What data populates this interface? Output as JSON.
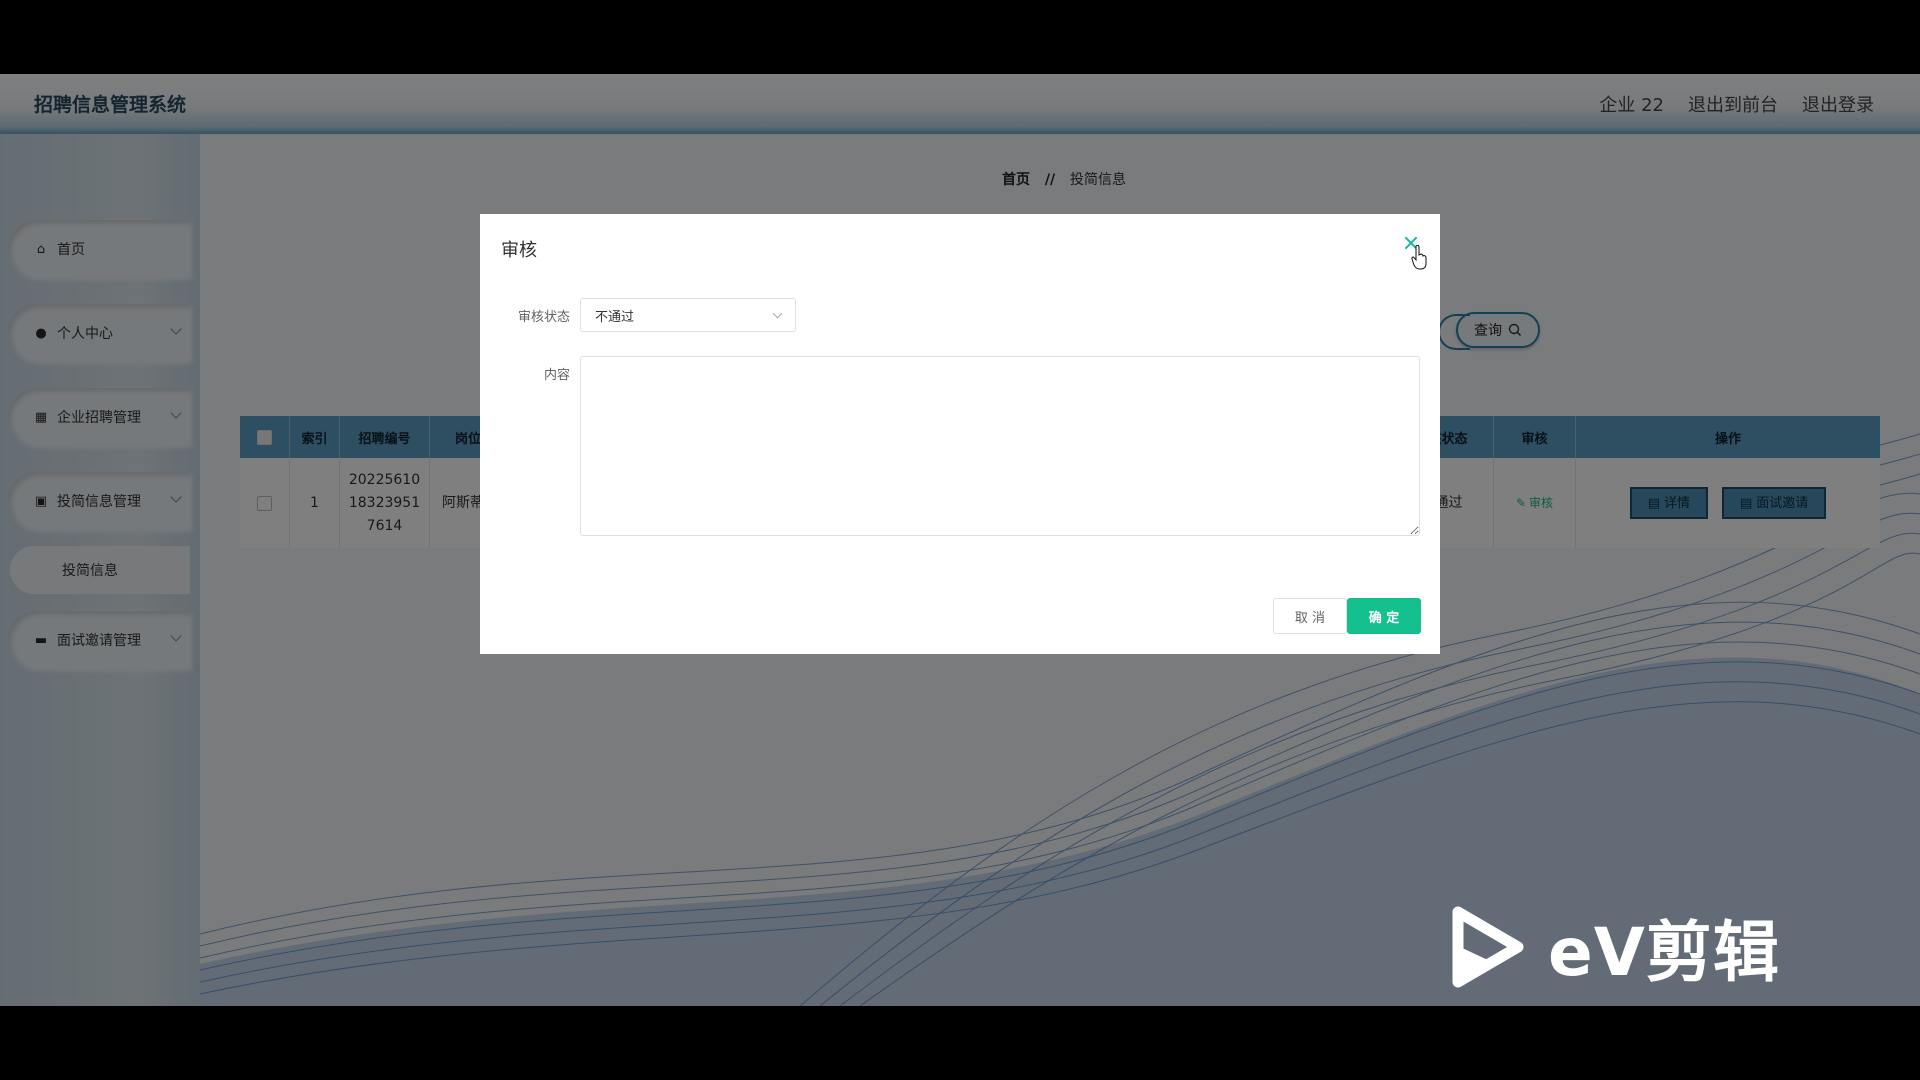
{
  "header": {
    "title": "招聘信息管理系统",
    "nav": [
      "企业 22",
      "退出到前台",
      "退出登录"
    ]
  },
  "sidebar": {
    "items": [
      {
        "label": "首页",
        "icon": "home-icon"
      },
      {
        "label": "个人中心",
        "icon": "user-icon"
      },
      {
        "label": "企业招聘管理",
        "icon": "grid-icon"
      },
      {
        "label": "投简信息管理",
        "icon": "clipboard-icon"
      },
      {
        "label": "投简信息",
        "icon": ""
      },
      {
        "label": "面试邀请管理",
        "icon": "briefcase-icon"
      }
    ]
  },
  "breadcrumb": {
    "home": "首页",
    "sep": "//",
    "current": "投简信息"
  },
  "search": {
    "query_label": "查询"
  },
  "table": {
    "headers": {
      "index": "索引",
      "code": "招聘编号",
      "position": "岗位名",
      "status": "审核状态",
      "review": "审核",
      "ops": "操作"
    },
    "rows": [
      {
        "index": "1",
        "code_lines": [
          "20225610",
          "18323951",
          "7614"
        ],
        "position": "阿斯蒂",
        "status": "未通过",
        "review": "审核",
        "detail": "详情",
        "invite": "面试邀请"
      }
    ]
  },
  "dialog": {
    "title": "审核",
    "status_label": "审核状态",
    "status_value": "不通过",
    "content_label": "内容",
    "content_value": "",
    "cancel": "取 消",
    "confirm": "确 定"
  },
  "watermark": {
    "text": "eV剪辑"
  },
  "colors": {
    "accent": "#14c08e",
    "header_blue": "#5b9ec2",
    "overlay": "rgba(0,0,0,0.5)"
  }
}
